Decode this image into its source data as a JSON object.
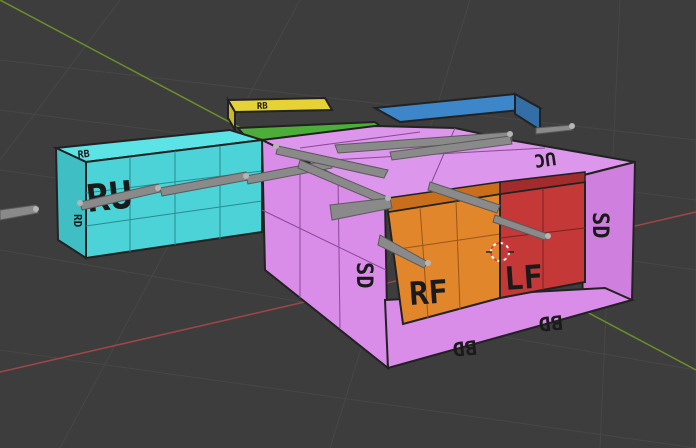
{
  "viewport": {
    "background_color": "#3d3d3d",
    "grid_color": "#474747",
    "x_axis_color": "#a04548",
    "y_axis_color": "#6a8f2a"
  },
  "blocks": {
    "yellow": {
      "color": "#e6d234",
      "label": "RB"
    },
    "blue": {
      "color": "#3d86c9",
      "label": ""
    },
    "green": {
      "color": "#4cae39",
      "label": ""
    },
    "cyan": {
      "color": "#4cd3d8",
      "label_main": "RU",
      "label_top": "RB",
      "label_side": "RD"
    },
    "pink": {
      "color": "#d98ce8",
      "label_top": "UC",
      "label_side_left": "SD",
      "label_side_right": "SD",
      "label_bottom_left": "BD",
      "label_bottom_right": "BD"
    },
    "orange": {
      "color": "#e2862c",
      "label": "RF"
    },
    "red": {
      "color": "#c43838",
      "label": "LF"
    }
  },
  "bones": {
    "color": "#8a8a8a",
    "joint_color": "#b5b5b5"
  },
  "origin_marker": {
    "color": "#ffffff"
  }
}
